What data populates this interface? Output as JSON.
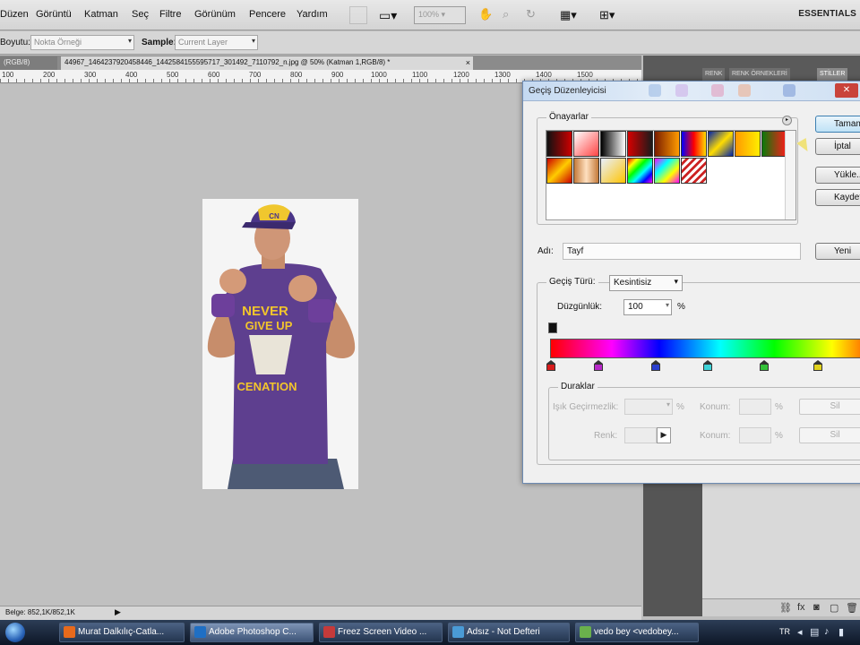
{
  "menubar": {
    "items": [
      "Düzen",
      "Görüntü",
      "Katman",
      "Seç",
      "Filtre",
      "Görünüm",
      "Pencere",
      "Yardım"
    ],
    "zoom": "100%",
    "workspace": "ESSENTIALS"
  },
  "options": {
    "sample_size_label": "Boyutu:",
    "sample_size_value": "Nokta Örneği",
    "sample_label": "Sample:",
    "sample_value": "Current Layer"
  },
  "tabs": {
    "tab1": "(RGB/8)",
    "tab2": "44967_1464237920458446_1442584155595717_301492_7110792_n.jpg @ 50% (Katman 1,RGB/8) *",
    "close": "×"
  },
  "ruler": {
    "labels": [
      "100",
      "200",
      "300",
      "400",
      "500",
      "600",
      "700",
      "800",
      "900",
      "1000",
      "1100",
      "1200",
      "1300",
      "1400",
      "1500"
    ]
  },
  "panel": {
    "tabs": [
      "RENK",
      "RENK ÖRNEKLERİ",
      "STİLLER"
    ]
  },
  "status": {
    "text": "Belge: 852,1K/852,1K",
    "arrow": "▶"
  },
  "dialog": {
    "title": "Geçiş Düzenleyicisi",
    "close": "✕",
    "presets_label": "Önayarlar",
    "buttons": {
      "ok": "Tamam",
      "cancel": "İptal",
      "load": "Yükle...",
      "save": "Kaydet...",
      "new": "Yeni"
    },
    "name_label": "Adı:",
    "name_value": "Tayf",
    "gradient_type_label": "Geçiş Türü:",
    "gradient_type_value": "Kesintisiz",
    "smoothness_label": "Düzgünlük:",
    "smoothness_value": "100",
    "percent": "%",
    "stops_label": "Duraklar",
    "opacity_label": "Işık Geçirmezlik:",
    "color_label": "Renk:",
    "location_label": "Konum:",
    "delete_label": "Sil",
    "preset_colors": [
      [
        "#111111",
        "#cc0000"
      ],
      [
        "#ffffff",
        "#ff4444"
      ],
      [
        "#000000",
        "#ffffff"
      ],
      [
        "#1a1a1a",
        "#d60000"
      ],
      [
        "#7a1d00",
        "#ff9b00"
      ],
      [
        "#0000ff",
        "#ff0000"
      ],
      [
        "#ffdd00",
        "#0022aa"
      ],
      [
        "#ff9900",
        "#ffee00"
      ],
      [
        "#0a7a0a",
        "#ff1a1a"
      ],
      [
        "#ffcc00",
        "#cc0000"
      ],
      [
        "#c47a3a",
        "#ffe0c0"
      ],
      [
        "#e8f0ff",
        "#ffc400"
      ],
      [
        "#ff0000",
        "#00ff00"
      ],
      [
        "#ff00ff",
        "#00ffff"
      ],
      [
        "#ffffff",
        "#cc2222"
      ]
    ],
    "stop_colors": [
      "#d81b1b",
      "#b829c8",
      "#2a3fcf",
      "#3fd3d8",
      "#34c23a",
      "#e1d21e"
    ]
  },
  "taskbar": {
    "items": [
      {
        "label": "Murat Dalkılıç-Catla...",
        "color": "#e86a1c"
      },
      {
        "label": "Adobe Photoshop C...",
        "color": "#1f6fc4"
      },
      {
        "label": "Freez Screen Video ...",
        "color": "#c63a3a"
      },
      {
        "label": "Adsız - Not Defteri",
        "color": "#4a9bd6"
      },
      {
        "label": "vedo bey <vedobey...",
        "color": "#6ab04c"
      }
    ],
    "lang": "TR"
  }
}
